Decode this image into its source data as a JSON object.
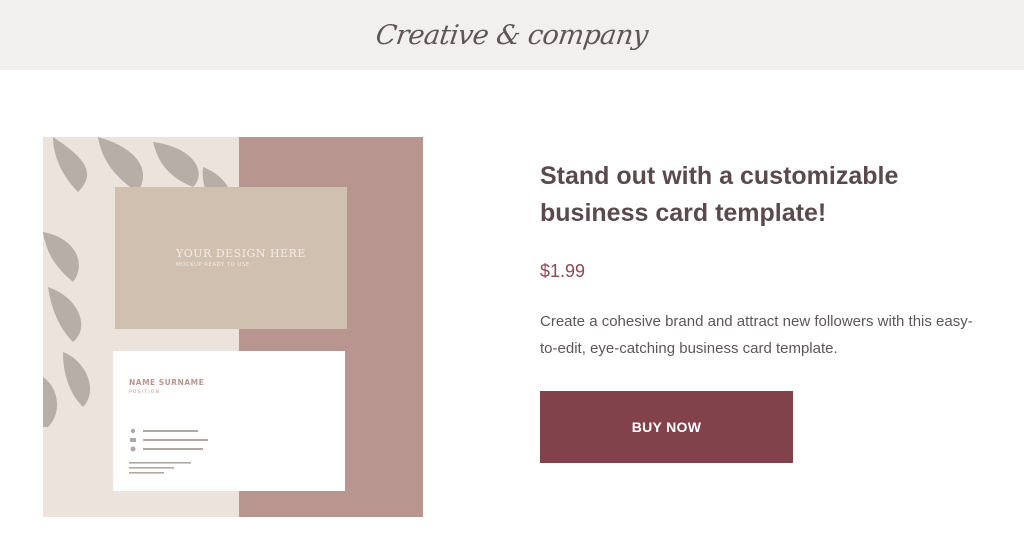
{
  "header": {
    "logo_text": "Creative & company"
  },
  "product": {
    "image": {
      "mockup_card_front_title": "YOUR DESIGN HERE",
      "mockup_card_front_subtitle": "MOCKUP READY TO USE",
      "mockup_card_back_name": "NAME SURNAME",
      "mockup_card_back_position": "POSITION",
      "colors": {
        "background_left": "#ede3dd",
        "background_right": "#b8968f",
        "card_front": "#cfc0b0",
        "card_back": "#ffffff",
        "leaf_shadow": "#a69e96"
      }
    },
    "title": "Stand out with a customizable business card template!",
    "price": "$1.99",
    "description": "Create a cohesive brand and attract new followers with this easy-to-edit, eye-catching business card template.",
    "buy_label": "BUY NOW"
  },
  "colors": {
    "header_bg": "#f2f0ee",
    "accent": "#82424b",
    "title": "#5a4a4d"
  }
}
